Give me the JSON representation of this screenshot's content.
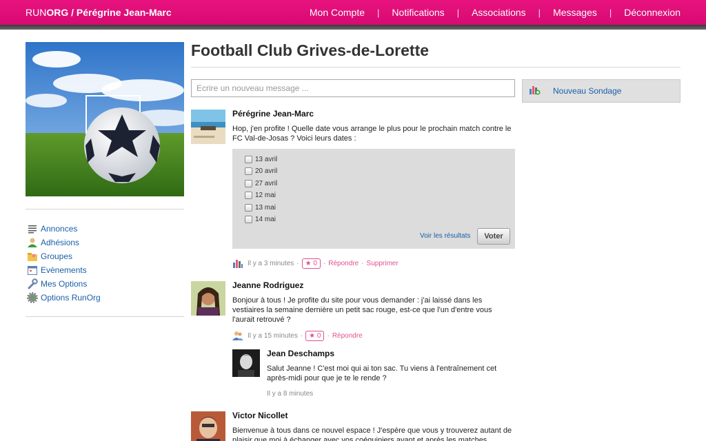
{
  "brand": {
    "part1": "RUN",
    "part2": "ORG",
    "sep": " / ",
    "user": "Pérégrine Jean-Marc"
  },
  "nav": {
    "items": [
      "Mon Compte",
      "Notifications",
      "Associations",
      "Messages",
      "Déconnexion"
    ],
    "separator": "|"
  },
  "sidebar": {
    "menu": [
      {
        "label": "Annonces",
        "icon": "list-icon"
      },
      {
        "label": "Adhésions",
        "icon": "member-icon"
      },
      {
        "label": "Groupes",
        "icon": "group-folder-icon"
      },
      {
        "label": "Evènements",
        "icon": "calendar-icon"
      },
      {
        "label": "Mes Options",
        "icon": "wrench-icon"
      },
      {
        "label": "Options RunOrg",
        "icon": "gear-icon"
      }
    ]
  },
  "main": {
    "title": "Football Club Grives-de-Lorette",
    "input_placeholder": "Ecrire un nouveau message ...",
    "poll_button": "Nouveau Sondage"
  },
  "posts": [
    {
      "author": "Pérégrine Jean-Marc",
      "text": "Hop, j'en profite ! Quelle date vous arrange le plus pour le prochain match contre le FC Val-de-Josas ? Voici leurs dates :",
      "poll": {
        "options": [
          "13 avril",
          "20 avril",
          "27 avril",
          "12 mai",
          "13 mai",
          "14 mai"
        ],
        "results_label": "Voir les résultats",
        "vote_label": "Voter"
      },
      "time": "Il y a 3 minutes",
      "likes": "★ 0",
      "reply": "Répondre",
      "delete": "Supprimer"
    },
    {
      "author": "Jeanne Rodriguez",
      "text": "Bonjour à tous ! Je profite du site pour vous demander : j'ai laissé dans les vestiaires la semaine dernière un petit sac rouge, est-ce que l'un d'entre vous l'aurait retrouvé ?",
      "time": "Il y a 15 minutes",
      "likes": "★ 0",
      "reply": "Répondre"
    },
    {
      "author": "Jean Deschamps",
      "text": "Salut Jeanne ! C'est moi qui ai ton sac. Tu viens à l'entraînement cet après-midi pour que je te le rende ?",
      "time": "Il y a 8 minutes"
    },
    {
      "author": "Victor Nicollet",
      "text": "Bienvenue à tous dans ce nouvel espace ! J'espère que vous y trouverez autant de plaisir que moi à échanger avec vos coéquipiers avant et après les matches."
    }
  ],
  "colors": {
    "brand": "#e0127c",
    "link": "#1a5fa8",
    "action": "#e0508e"
  }
}
